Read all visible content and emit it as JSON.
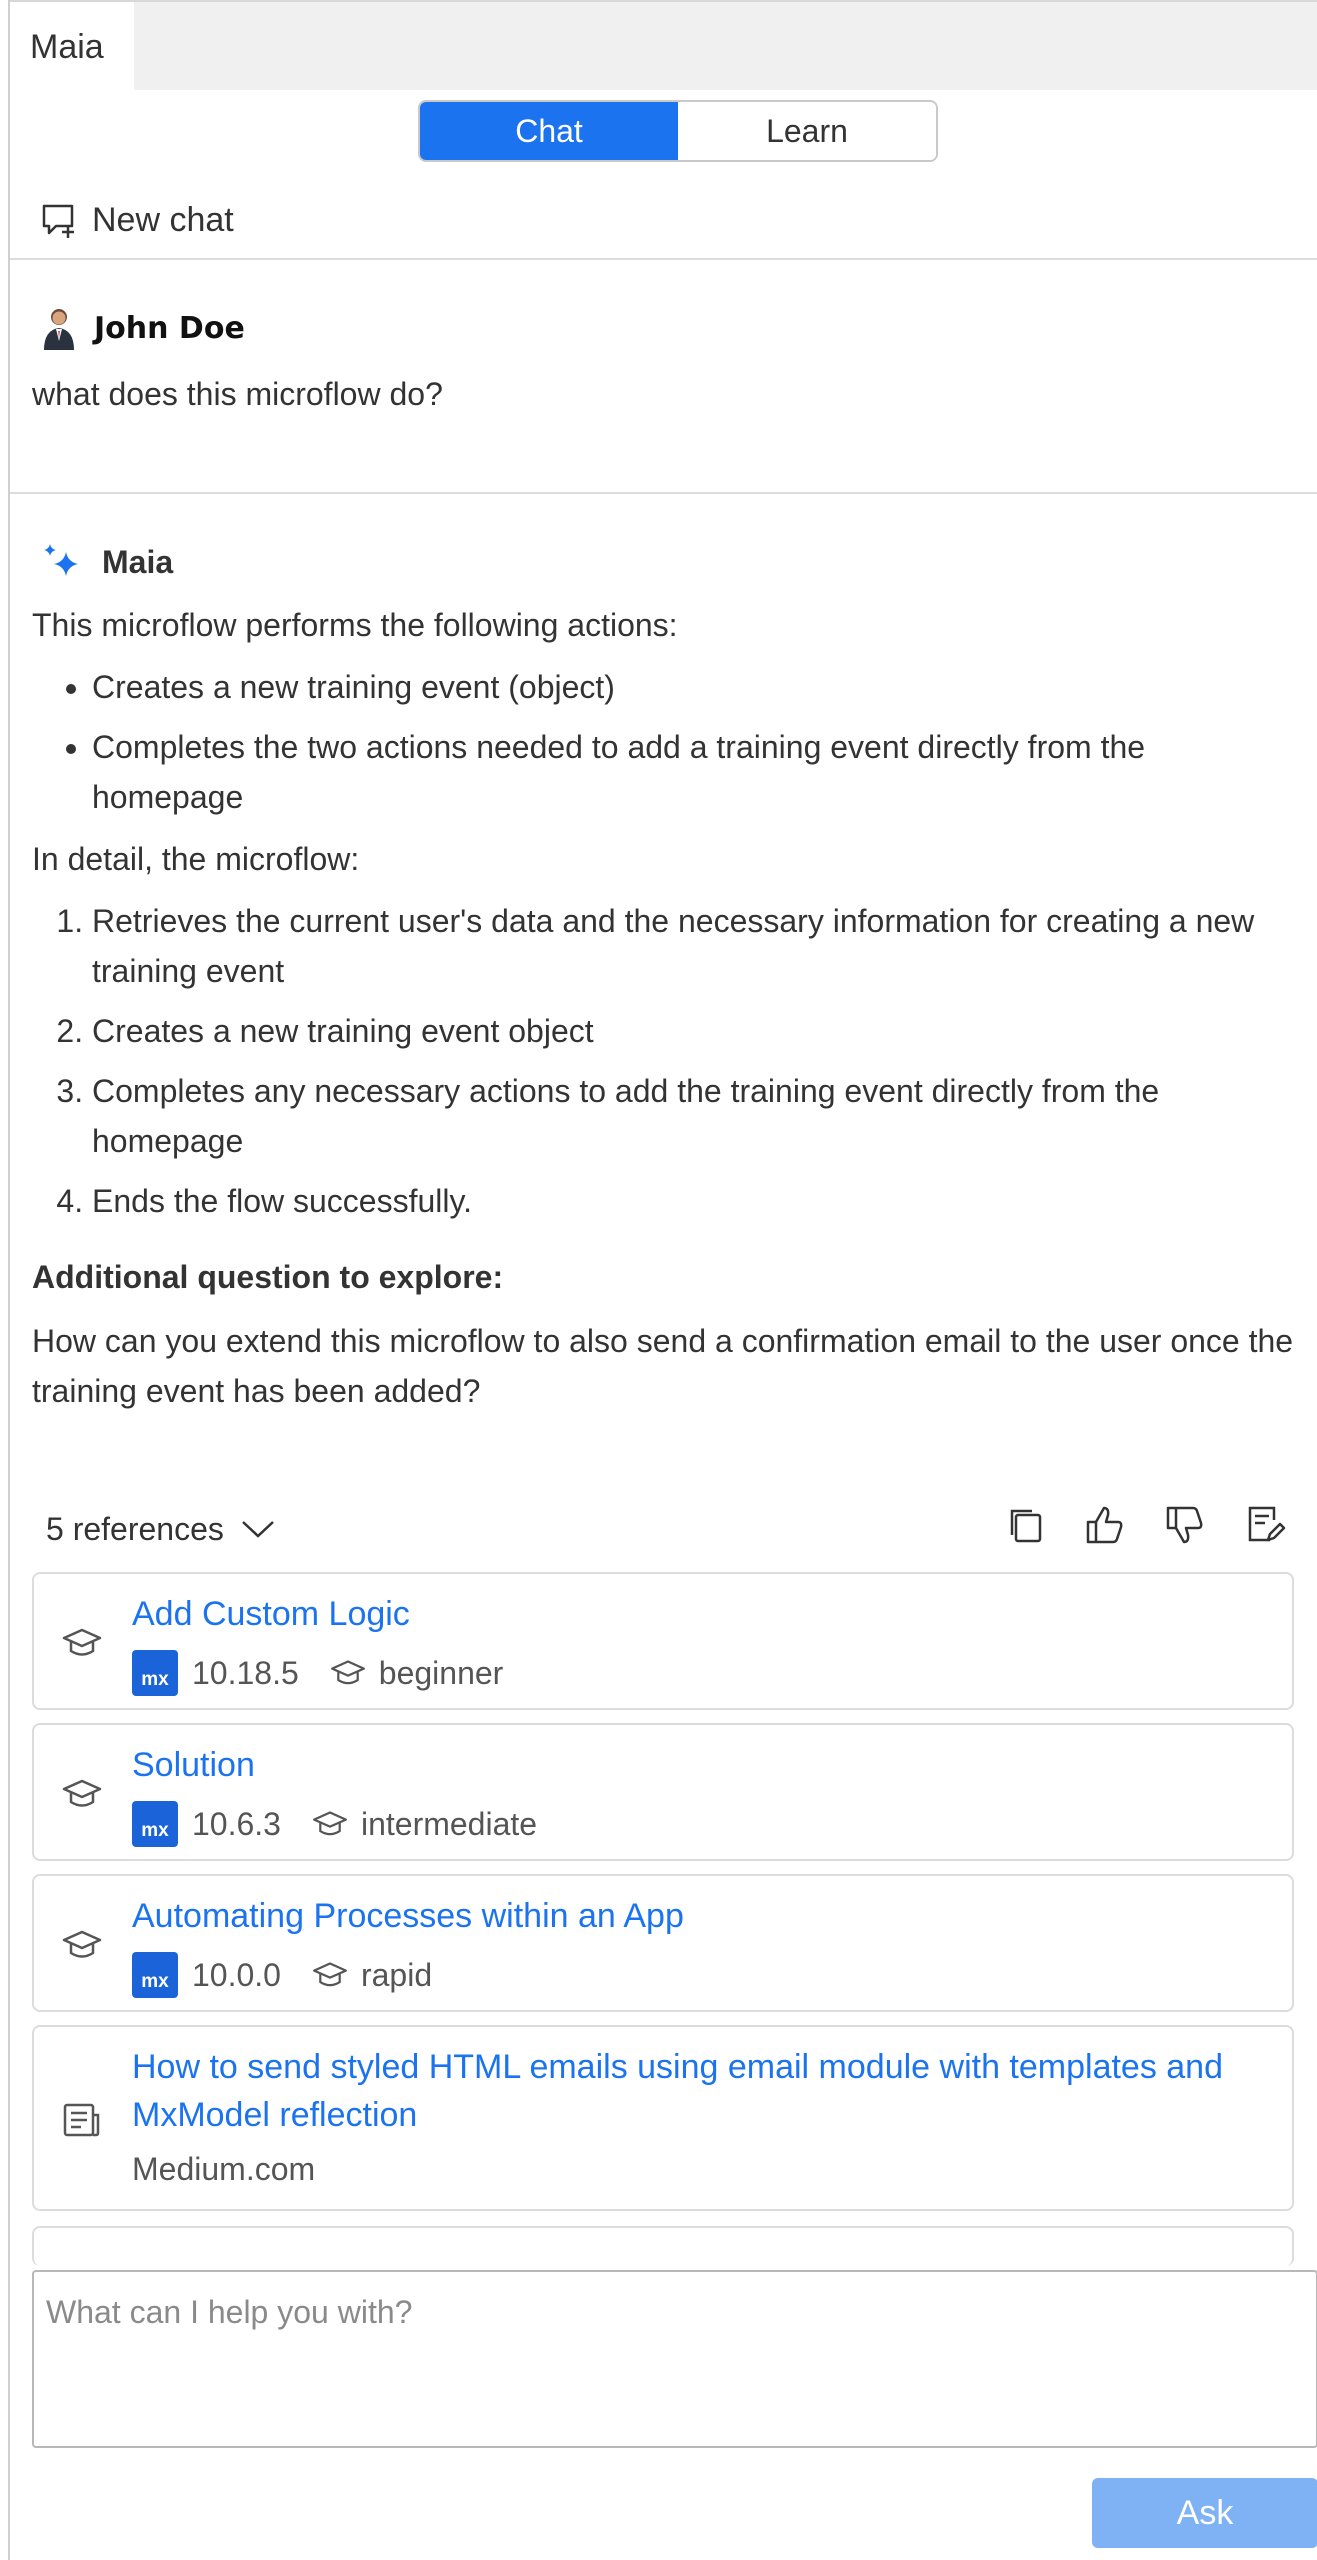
{
  "window": {
    "tab_title": "Maia"
  },
  "mode_switch": {
    "options": [
      "Chat",
      "Learn"
    ],
    "active": "Chat"
  },
  "toolbar": {
    "new_chat_label": "New chat",
    "new_chat_icon": "new-chat-icon"
  },
  "user_message": {
    "author": "John Doe",
    "text": "what does this microflow do?"
  },
  "assistant_message": {
    "author": "Maia",
    "intro": "This microflow performs the following actions:",
    "bullets": [
      "Creates a new training event (object)",
      "Completes the two actions needed to add a training event directly from the homepage"
    ],
    "detail_intro": "In detail, the microflow:",
    "steps": [
      "Retrieves the current user's data and the necessary information for creating a new training event",
      "Creates a new training event object",
      "Completes any necessary actions to add the training event directly from the homepage",
      "Ends the flow successfully."
    ],
    "additional_heading": "Additional question to explore:",
    "additional_question": "How can you extend this microflow to also send a confirmation email to the user once the training event has been added?"
  },
  "references": {
    "toggle_label": "5 references",
    "action_icons": [
      "copy-icon",
      "thumbs-up-icon",
      "thumbs-down-icon",
      "feedback-edit-icon"
    ],
    "items": [
      {
        "title": "Add Custom Logic",
        "version": "10.18.5",
        "level": "beginner",
        "badge": "mx",
        "type": "learning"
      },
      {
        "title": "Solution",
        "version": "10.6.3",
        "level": "intermediate",
        "badge": "mx",
        "type": "learning"
      },
      {
        "title": "Automating Processes within an App",
        "version": "10.0.0",
        "level": "rapid",
        "badge": "mx",
        "type": "learning"
      },
      {
        "title": "How to send styled HTML emails using email module with templates and MxModel reflection",
        "source": "Medium.com",
        "type": "article"
      }
    ]
  },
  "composer": {
    "placeholder": "What can I help you with?",
    "submit_label": "Ask"
  },
  "colors": {
    "accent": "#1b73f0",
    "ask_disabled": "#7fb1f5",
    "mx_badge": "#1b63d8"
  }
}
